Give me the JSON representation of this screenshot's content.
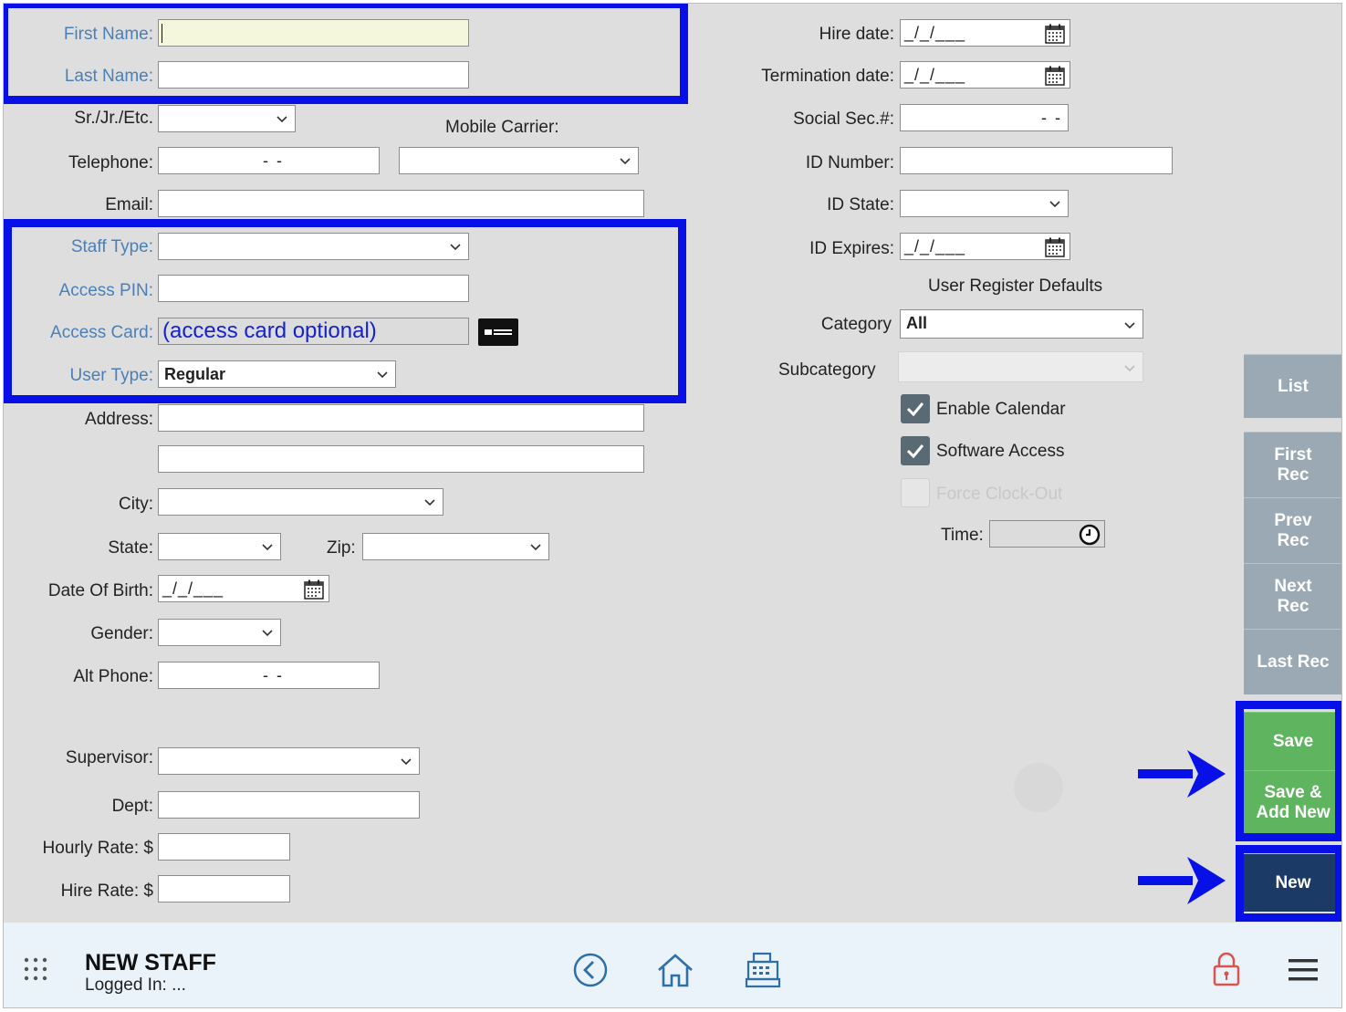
{
  "form_left": {
    "first_name": {
      "label": "First Name:",
      "value": ""
    },
    "last_name": {
      "label": "Last Name:",
      "value": ""
    },
    "suffix": {
      "label": "Sr./Jr./Etc.",
      "value": ""
    },
    "mobile_carrier": {
      "label": "Mobile Carrier:",
      "value": ""
    },
    "telephone": {
      "label": "Telephone:",
      "mask": "-   -"
    },
    "email": {
      "label": "Email:",
      "value": ""
    },
    "staff_type": {
      "label": "Staff Type:",
      "value": ""
    },
    "access_pin": {
      "label": "Access PIN:",
      "value": ""
    },
    "access_card": {
      "label": "Access Card:",
      "value": "(access card optional)"
    },
    "user_type": {
      "label": "User Type:",
      "value": "Regular"
    },
    "address": {
      "label": "Address:",
      "line1": "",
      "line2": ""
    },
    "city": {
      "label": "City:",
      "value": ""
    },
    "state": {
      "label": "State:",
      "value": ""
    },
    "zip": {
      "label": "Zip:",
      "value": ""
    },
    "dob": {
      "label": "Date Of Birth:",
      "mask": "_/_/___"
    },
    "gender": {
      "label": "Gender:",
      "value": ""
    },
    "alt_phone": {
      "label": "Alt Phone:",
      "mask": "-   -"
    },
    "supervisor": {
      "label": "Supervisor:",
      "value": ""
    },
    "dept": {
      "label": "Dept:",
      "value": ""
    },
    "hourly_rate": {
      "label": "Hourly Rate: $",
      "value": ""
    },
    "hire_rate": {
      "label": "Hire Rate: $",
      "value": ""
    }
  },
  "form_right": {
    "hire_date": {
      "label": "Hire date:",
      "mask": "_/_/___"
    },
    "termination_date": {
      "label": "Termination date:",
      "mask": "_/_/___"
    },
    "ssn": {
      "label": "Social Sec.#:",
      "mask": "-  -"
    },
    "id_number": {
      "label": "ID Number:",
      "value": ""
    },
    "id_state": {
      "label": "ID State:",
      "value": ""
    },
    "id_expires": {
      "label": "ID Expires:",
      "mask": "_/_/___"
    },
    "register_defaults_heading": "User Register Defaults",
    "category": {
      "label": "Category",
      "value": "All"
    },
    "subcategory": {
      "label": "Subcategory",
      "value": ""
    },
    "enable_calendar": {
      "label": "Enable Calendar",
      "checked": true
    },
    "software_access": {
      "label": "Software Access",
      "checked": true
    },
    "force_clock_out": {
      "label": "Force Clock-Out",
      "checked": false
    },
    "time": {
      "label": "Time:",
      "value": ""
    }
  },
  "side_buttons": {
    "list": "List",
    "first_rec": "First Rec",
    "prev_rec": "Prev Rec",
    "next_rec": "Next Rec",
    "last_rec": "Last Rec",
    "save": "Save",
    "save_add_new": "Save & Add New",
    "new": "New"
  },
  "footer": {
    "title": "NEW STAFF",
    "logged_in": "Logged In: ..."
  },
  "colors": {
    "highlight": "#0810e8",
    "save_green": "#5fb55f",
    "new_navy": "#1b3a66",
    "nav_gray": "#9ba9b4",
    "label_blue": "#4a7fb8"
  }
}
